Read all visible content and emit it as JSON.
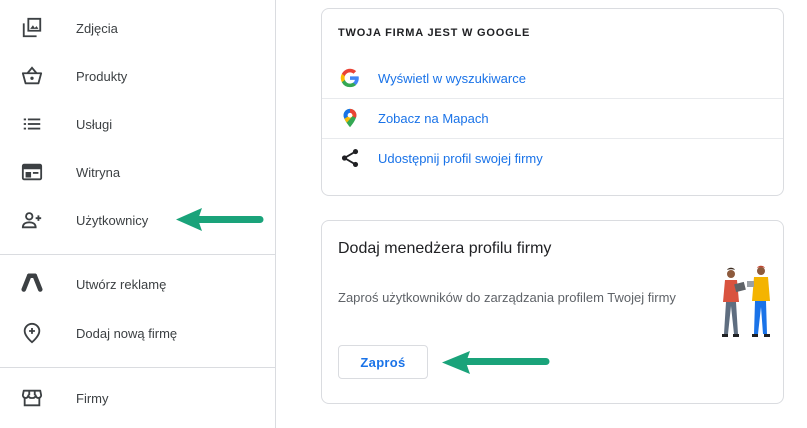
{
  "sidebar": {
    "items": [
      {
        "label": "Zdjęcia",
        "icon": "photos-icon"
      },
      {
        "label": "Produkty",
        "icon": "basket-icon"
      },
      {
        "label": "Usługi",
        "icon": "list-icon"
      },
      {
        "label": "Witryna",
        "icon": "website-icon"
      },
      {
        "label": "Użytkownicy",
        "icon": "add-user-icon"
      },
      {
        "label": "Utwórz reklamę",
        "icon": "google-ads-icon"
      },
      {
        "label": "Dodaj nową firmę",
        "icon": "add-location-icon"
      },
      {
        "label": "Firmy",
        "icon": "storefront-icon"
      }
    ]
  },
  "business_card": {
    "heading": "TWOJA FIRMA JEST W GOOGLE",
    "links": [
      {
        "label": "Wyświetl w wyszukiwarce",
        "icon": "google-g-icon"
      },
      {
        "label": "Zobacz na Mapach",
        "icon": "google-maps-pin-icon"
      },
      {
        "label": "Udostępnij profil swojej firmy",
        "icon": "share-icon"
      }
    ]
  },
  "manager_card": {
    "title": "Dodaj menedżera profilu firmy",
    "description": "Zaproś użytkowników do zarządzania profilem Twojej firmy",
    "button_label": "Zaproś",
    "illustration": "two-people-illustration"
  },
  "colors": {
    "link": "#1a73e8",
    "arrow": "#1aa37a",
    "divider": "#dadce0"
  }
}
